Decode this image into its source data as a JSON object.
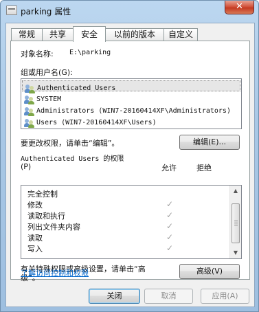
{
  "window": {
    "title": "parking 属性",
    "close_glyph": "✕"
  },
  "tabs": [
    {
      "label": "常规"
    },
    {
      "label": "共享"
    },
    {
      "label": "安全"
    },
    {
      "label": "以前的版本"
    },
    {
      "label": "自定义"
    }
  ],
  "security": {
    "object_label": "对象名称:",
    "object_value": "E:\\parking",
    "groups_label": "组或用户名(G):",
    "groups": [
      {
        "name": "Authenticated Users"
      },
      {
        "name": "SYSTEM"
      },
      {
        "name": "Administrators (WIN7-20160414XF\\Administrators)"
      },
      {
        "name": "Users (WIN7-20160414XF\\Users)"
      }
    ],
    "change_hint": "要更改权限，请单击“编辑”。",
    "edit_button": "编辑(E)...",
    "perm_title": "Authenticated Users 的权限",
    "perm_mnemonic": "(P)",
    "allow_header": "允许",
    "deny_header": "拒绝",
    "permissions": [
      {
        "name": "完全控制",
        "allow": false
      },
      {
        "name": "修改",
        "allow": true
      },
      {
        "name": "读取和执行",
        "allow": true
      },
      {
        "name": "列出文件夹内容",
        "allow": true
      },
      {
        "name": "读取",
        "allow": true
      },
      {
        "name": "写入",
        "allow": true
      }
    ],
    "check_glyph": "✓",
    "advanced_hint_line1": "有关特殊权限或高级设置，请单击“高",
    "advanced_hint_line2": "级”。",
    "advanced_button": "高级(V)",
    "link": "了解访问控制和权限"
  },
  "footer": {
    "close_button": "关闭",
    "cancel_button": "取消",
    "apply_button": "应用(A)"
  }
}
